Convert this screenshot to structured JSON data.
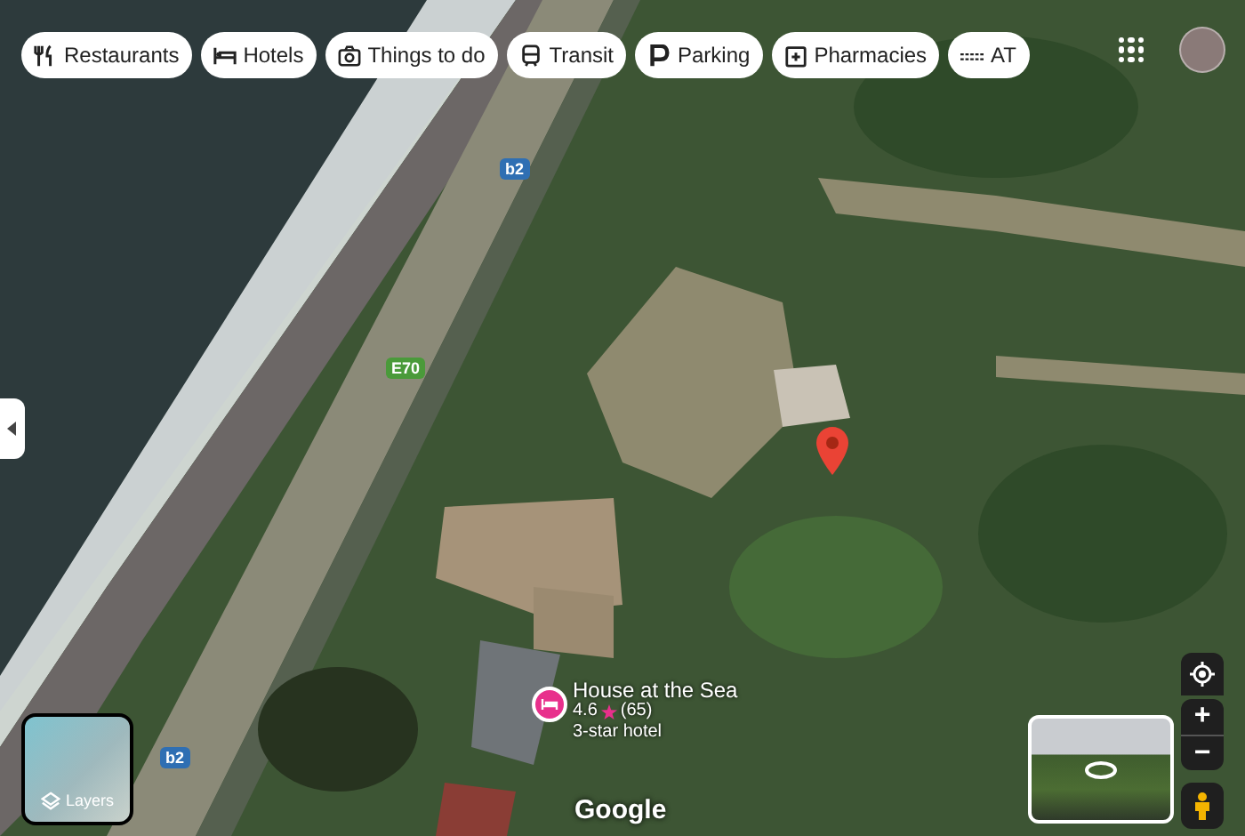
{
  "category_chips": [
    {
      "label": "Restaurants"
    },
    {
      "label": "Hotels"
    },
    {
      "label": "Things to do"
    },
    {
      "label": "Transit"
    },
    {
      "label": "Parking"
    },
    {
      "label": "Pharmacies"
    },
    {
      "label": "AT"
    }
  ],
  "road_labels": [
    {
      "text": "b2",
      "kind": "national"
    },
    {
      "text": "E70",
      "kind": "european"
    },
    {
      "text": "b2",
      "kind": "national"
    }
  ],
  "place": {
    "name": "House at the Sea",
    "rating": "4.6",
    "reviews": "(65)",
    "category": "3-star hotel"
  },
  "layers_button": {
    "label": "Layers"
  },
  "zoom_controls": {
    "zoom_in": "+",
    "zoom_out": "−"
  },
  "attribution": "Google"
}
